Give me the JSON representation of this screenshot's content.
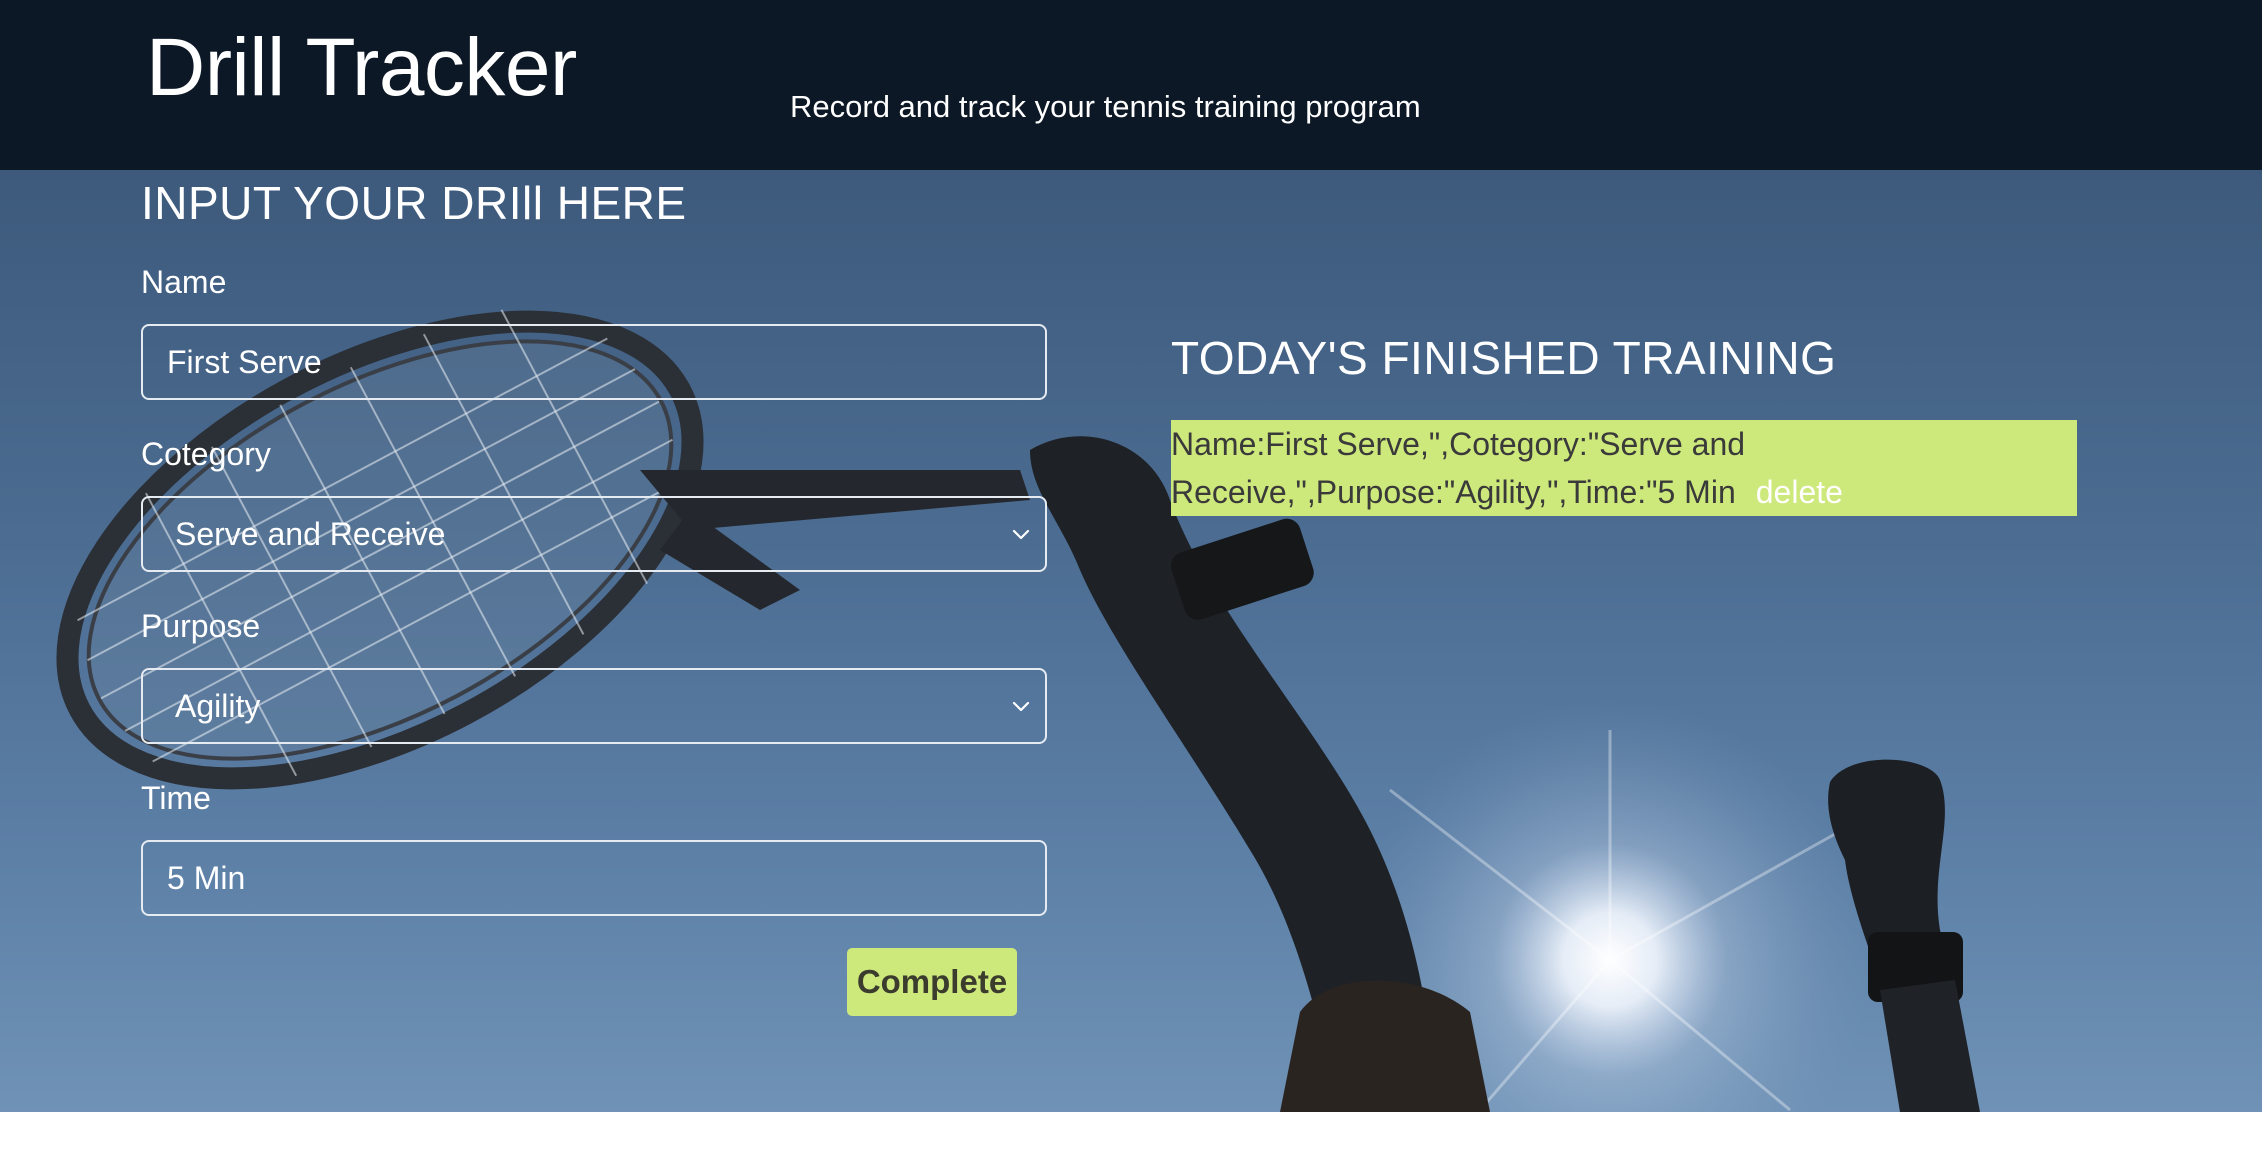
{
  "header": {
    "title": "Drill Tracker",
    "subtitle": "Record and track your tennis training program"
  },
  "form": {
    "title": "INPUT YOUR DRIll HERE",
    "name_label": "Name",
    "name_value": "First Serve",
    "category_label": "Cotegory",
    "category_value": "Serve and Receive",
    "purpose_label": "Purpose",
    "purpose_value": "Agility",
    "time_label": "Time",
    "time_value": "5 Min",
    "submit_label": "Complete"
  },
  "finished": {
    "title": "TODAY'S FINISHED TRAINING",
    "records": [
      {
        "line1": "Name:First Serve,\",Cotegory:\"Serve and",
        "line2": "Receive,\",Purpose:\"Agility,\",Time:\"5 Min",
        "delete_label": "delete"
      }
    ]
  },
  "colors": {
    "header_bg": "#0d1826",
    "accent": "#cde87b",
    "text_light": "#ffffff"
  },
  "icons": {
    "select_arrow": "chevron-down-icon"
  }
}
